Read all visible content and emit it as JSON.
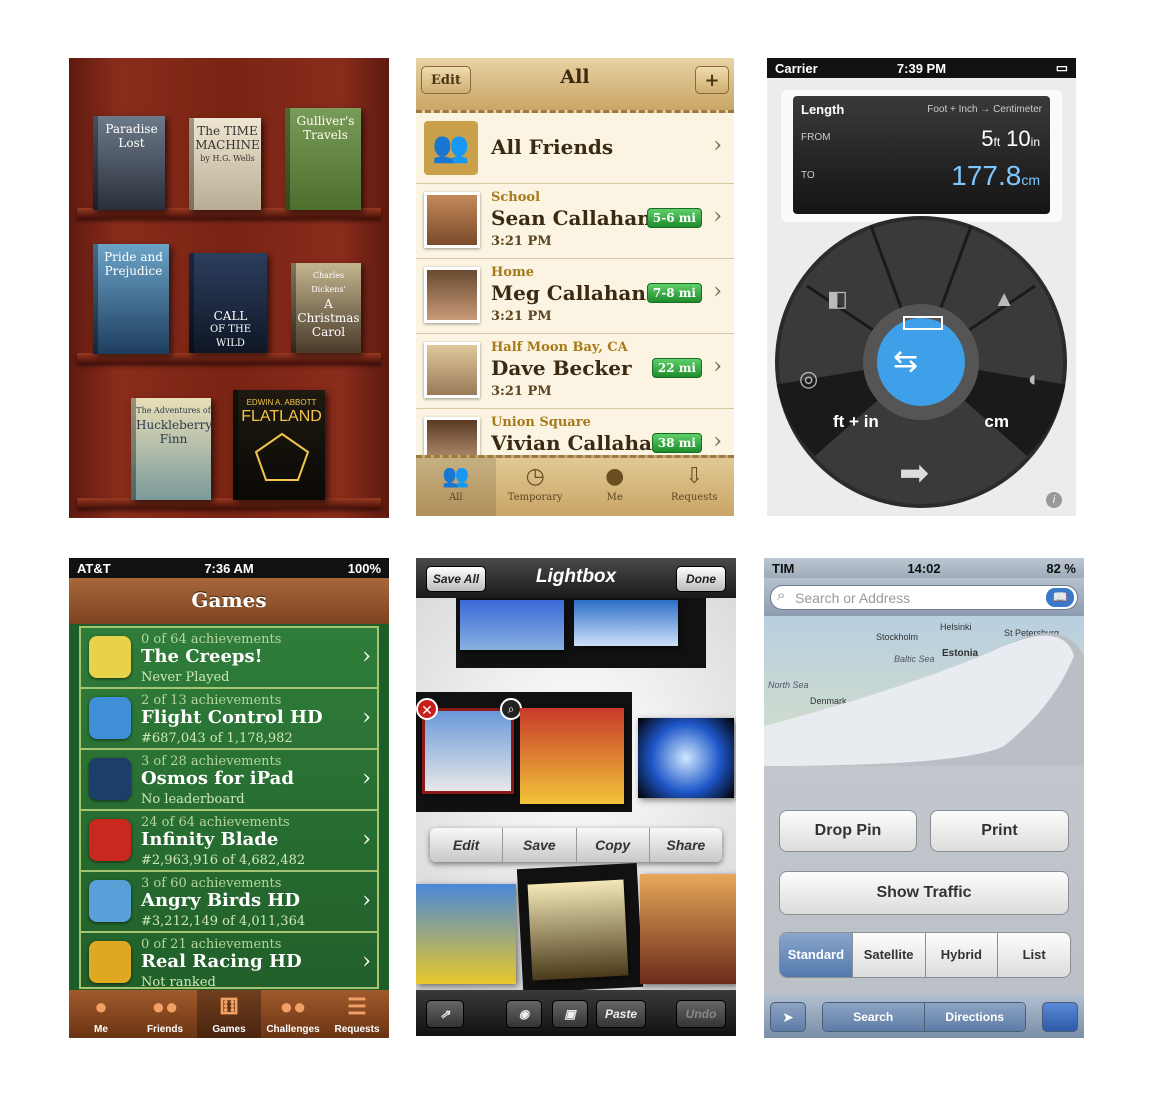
{
  "books": {
    "titles": [
      "Paradise Lost",
      "The Time Machine",
      "Gulliver's Travels",
      "Pride and Prejudice",
      "Call of the Wild",
      "A Christmas Carol",
      "Huckleberry Finn",
      "Flatland"
    ],
    "row1": [
      {
        "t1": "Paradise",
        "t2": "Lost",
        "sub": ""
      },
      {
        "t1": "The TIME",
        "t2": "MACHINE",
        "sub": "by H.G. Wells"
      },
      {
        "t1": "Gulliver's",
        "t2": "Travels",
        "sub": ""
      }
    ],
    "row2": [
      {
        "t1": "Pride and",
        "t2": "Prejudice",
        "sub": ""
      },
      {
        "t1": "CALL",
        "t2": "OF THE WILD",
        "sub": ""
      },
      {
        "t1": "Charles Dickens'",
        "t2": "A Christmas Carol",
        "sub": ""
      }
    ],
    "row3": [
      {
        "t1": "The Adventures of",
        "t2": "Huckleberry Finn",
        "sub": ""
      },
      {
        "t1": "EDWIN A. ABBOTT",
        "t2": "FLATLAND",
        "sub": ""
      }
    ]
  },
  "find_friends": {
    "edit": "Edit",
    "title": "All",
    "add": "+",
    "all_friends": "All Friends",
    "rows": [
      {
        "category": "School",
        "name": "Sean Callahan",
        "time": "3:21 PM",
        "distance": "5-6 mi"
      },
      {
        "category": "Home",
        "name": "Meg Callahan",
        "time": "3:21 PM",
        "distance": "7-8 mi"
      },
      {
        "category": "Half Moon Bay, CA",
        "name": "Dave Becker",
        "time": "3:21 PM",
        "distance": "22 mi"
      },
      {
        "category": "Union Square",
        "name": "Vivian Callahan",
        "time": "",
        "distance": "38 mi"
      }
    ],
    "tabs": [
      "All",
      "Temporary",
      "Me",
      "Requests"
    ]
  },
  "convert": {
    "carrier": "Carrier",
    "time": "7:39 PM",
    "category": "Length",
    "units_caption": "Foot + Inch → Centimeter",
    "from_label": "FROM",
    "to_label": "TO",
    "from_ft": "5",
    "from_ft_unit": "ft",
    "from_in": "10",
    "from_in_unit": "in",
    "to_value": "177.8",
    "to_unit": "cm",
    "left_unit": "ft + in",
    "right_unit": "cm"
  },
  "game_center": {
    "carrier": "AT&T",
    "time": "7:36 AM",
    "battery": "100%",
    "title": "Games",
    "games": [
      {
        "ach": "0 of 64 achievements",
        "name": "The Creeps!",
        "sub": "Never Played",
        "color": "#e8d24a"
      },
      {
        "ach": "2 of 13 achievements",
        "name": "Flight Control HD",
        "sub": "#687,043 of 1,178,982",
        "color": "#3f8fd8"
      },
      {
        "ach": "3 of 28 achievements",
        "name": "Osmos for iPad",
        "sub": "No leaderboard",
        "color": "#1d3d6a"
      },
      {
        "ach": "24 of 64 achievements",
        "name": "Infinity Blade",
        "sub": "#2,963,916 of 4,682,482",
        "color": "#c8281e"
      },
      {
        "ach": "3 of 60 achievements",
        "name": "Angry Birds HD",
        "sub": "#3,212,149 of 4,011,364",
        "color": "#5aa0d8"
      },
      {
        "ach": "0 of 21 achievements",
        "name": "Real Racing HD",
        "sub": "Not ranked",
        "color": "#e0a820"
      }
    ],
    "tabs": [
      "Me",
      "Friends",
      "Games",
      "Challenges",
      "Requests"
    ]
  },
  "lightbox": {
    "save_all": "Save All",
    "title": "Lightbox",
    "done": "Done",
    "menu": [
      "Edit",
      "Save",
      "Copy",
      "Share"
    ],
    "paste": "Paste",
    "undo": "Undo"
  },
  "maps": {
    "carrier": "TIM",
    "time": "14:02",
    "battery": "82 %",
    "search_placeholder": "Search or Address",
    "map_labels": [
      "Helsinki",
      "Stockholm",
      "St Petersburg",
      "Estonia",
      "Denmark",
      "Baltic Sea",
      "North Sea"
    ],
    "drop_pin": "Drop Pin",
    "print": "Print",
    "show_traffic": "Show Traffic",
    "view_modes": [
      "Standard",
      "Satellite",
      "Hybrid",
      "List"
    ],
    "bottom_tabs": [
      "Search",
      "Directions"
    ]
  }
}
